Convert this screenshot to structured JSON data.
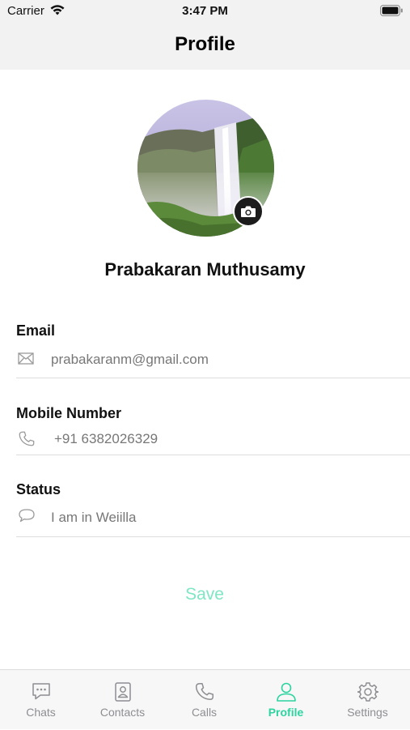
{
  "status_bar": {
    "carrier": "Carrier",
    "time": "3:47 PM"
  },
  "nav": {
    "title": "Profile"
  },
  "profile": {
    "name": "Prabakaran Muthusamy"
  },
  "fields": [
    {
      "label": "Email",
      "icon": "mail-icon",
      "value": "prabakaranm@gmail.com"
    },
    {
      "label": "Mobile Number",
      "icon": "phone-icon",
      "value": "+91 6382026329"
    },
    {
      "label": "Status",
      "icon": "speech-bubble-icon",
      "value": "I am in Weiilla"
    }
  ],
  "save_label": "Save",
  "tabs": [
    {
      "label": "Chats",
      "icon": "chat-icon",
      "active": false
    },
    {
      "label": "Contacts",
      "icon": "contacts-icon",
      "active": false
    },
    {
      "label": "Calls",
      "icon": "phone-icon",
      "active": false
    },
    {
      "label": "Profile",
      "icon": "person-icon",
      "active": true
    },
    {
      "label": "Settings",
      "icon": "gear-icon",
      "active": false
    }
  ],
  "colors": {
    "accent": "#2dd4a0",
    "save": "#7ee6c4",
    "bar_bg": "#f2f2f2"
  }
}
